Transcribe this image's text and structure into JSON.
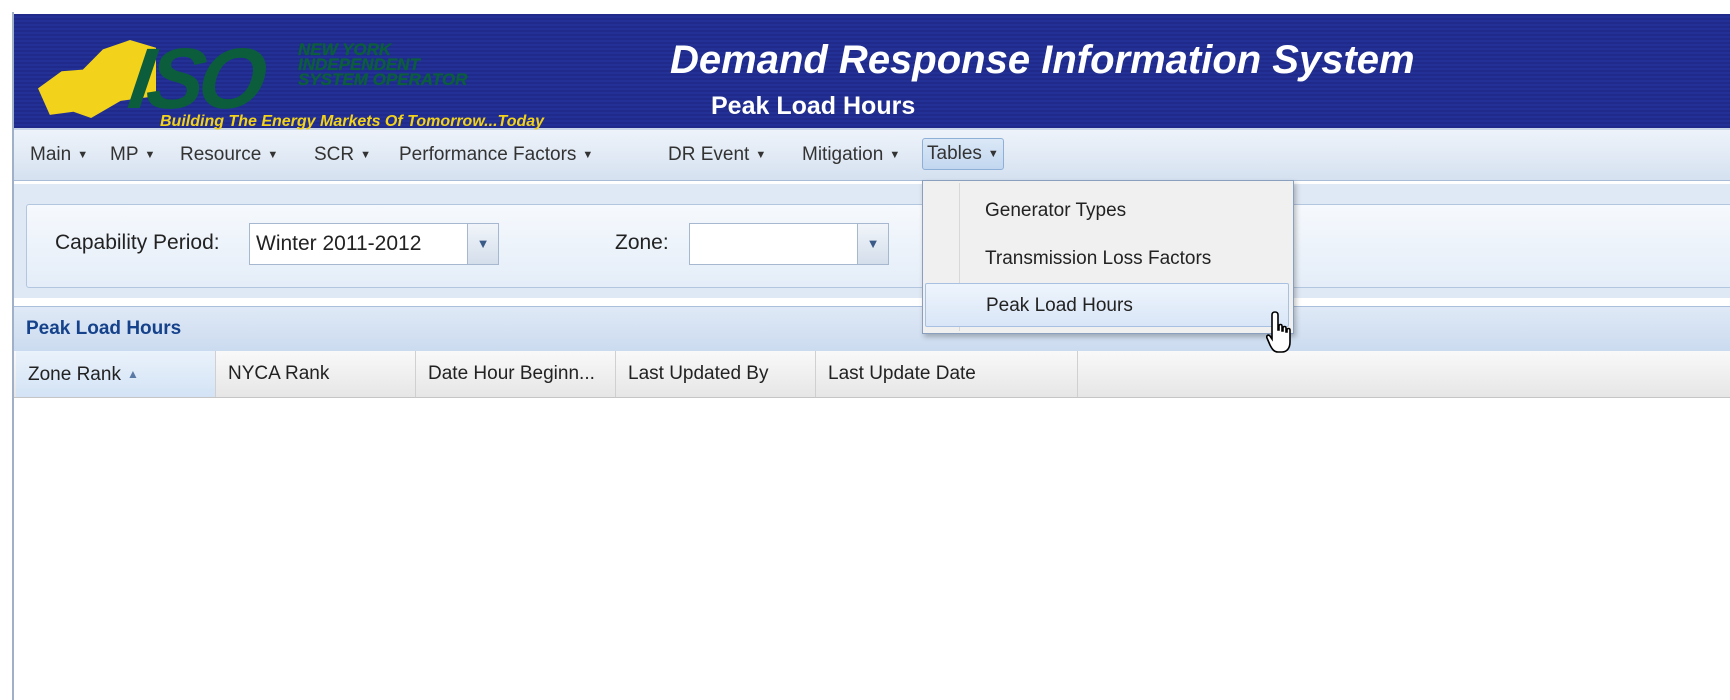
{
  "header": {
    "logo": {
      "word": "ISO",
      "org_lines": [
        "NEW YORK",
        "INDEPENDENT",
        "SYSTEM OPERATOR"
      ],
      "tagline": "Building The Energy Markets Of Tomorrow...Today"
    },
    "app_title": "Demand Response Information System",
    "page_subtitle": "Peak Load Hours"
  },
  "menubar": {
    "items": [
      {
        "label": "Main"
      },
      {
        "label": "MP"
      },
      {
        "label": "Resource"
      },
      {
        "label": "SCR"
      },
      {
        "label": "Performance Factors"
      },
      {
        "label": "DR Event"
      },
      {
        "label": "Mitigation"
      },
      {
        "label": "Tables",
        "active": true
      }
    ]
  },
  "tables_menu": {
    "items": [
      {
        "label": "Generator Types"
      },
      {
        "label": "Transmission Loss Factors"
      },
      {
        "label": "Peak Load Hours",
        "hover": true
      }
    ]
  },
  "filters": {
    "capability_period": {
      "label": "Capability Period:",
      "value": "Winter 2011-2012"
    },
    "zone": {
      "label": "Zone:",
      "value": ""
    }
  },
  "grid": {
    "title": "Peak Load Hours",
    "columns": [
      {
        "label": "Zone Rank",
        "sorted": "asc"
      },
      {
        "label": "NYCA Rank"
      },
      {
        "label": "Date Hour Beginn..."
      },
      {
        "label": "Last Updated By"
      },
      {
        "label": "Last Update Date"
      }
    ],
    "rows": []
  },
  "colors": {
    "header_bg": "#1f2a8a",
    "logo_green": "#0b5d3c",
    "logo_yellow": "#f2d21b",
    "panel_title": "#15428b"
  }
}
